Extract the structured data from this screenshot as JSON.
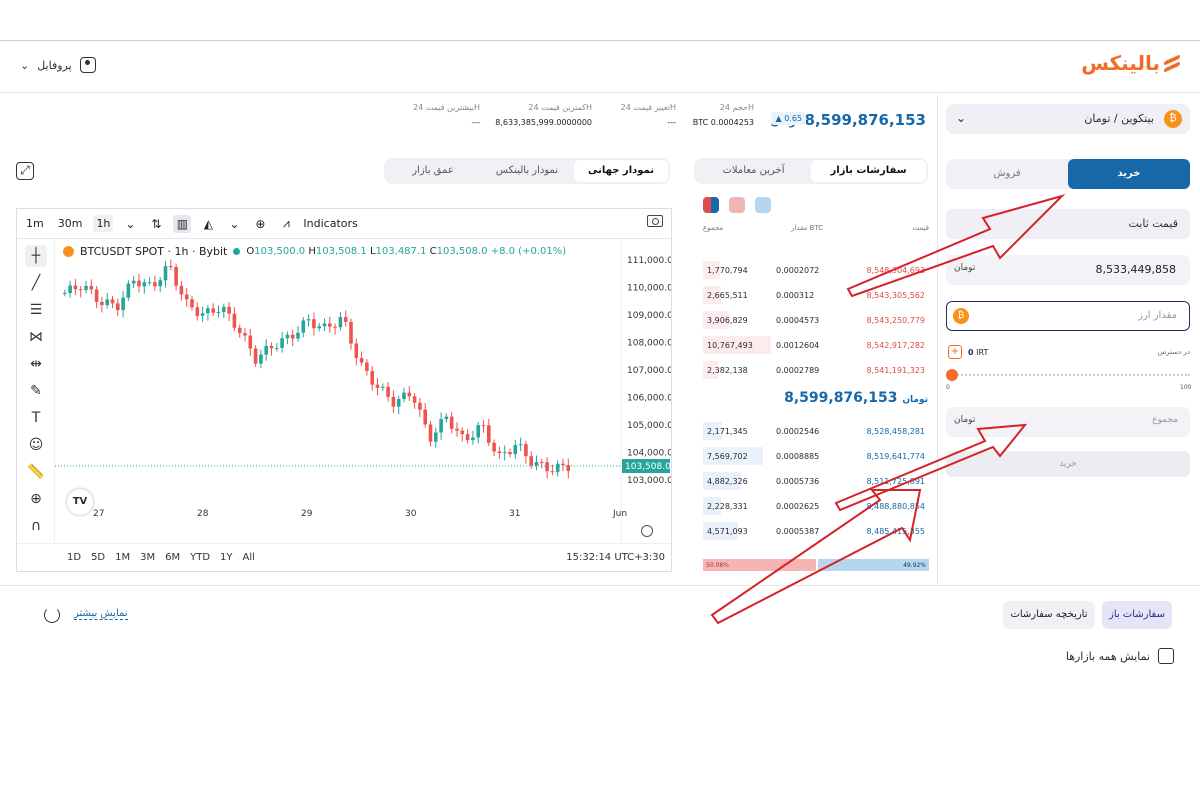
{
  "header": {
    "brand": "بالینکس",
    "profile_label": "پروفایل"
  },
  "stats": {
    "last_price": "8,599,876,153",
    "change_pct": "0.65",
    "volume_label": "حجم 24H",
    "volume_value": "BTC 0.0004253",
    "change_label": "تغییر قیمت 24H",
    "change_value": "---",
    "low_label": "کمترین قیمت 24H",
    "low_value": "8,633,385,999.0000000",
    "high_label": "بیشترین قیمت 24H",
    "high_value": "---"
  },
  "chart_tabs": [
    "نمودار جهانی",
    "نمودار بالینکس",
    "عمق بازار"
  ],
  "tv": {
    "timeframes": [
      "1m",
      "30m",
      "1h"
    ],
    "indicators_label": "Indicators",
    "symbol": "BTCUSDT SPOT · 1h · Bybit",
    "ohlc": {
      "o": "103,500.0",
      "h": "103,508.1",
      "l": "103,487.1",
      "c": "103,508.0",
      "chg": "+8.0 (+0.01%)"
    },
    "price_ticks": [
      "111,000.0",
      "110,000.0",
      "109,000.0",
      "108,000.0",
      "107,000.0",
      "106,000.0",
      "105,000.0",
      "104,000.0",
      "103,000.0"
    ],
    "last_tag": "103,508.0",
    "date_ticks": [
      "27",
      "28",
      "29",
      "30",
      "31",
      "Jun"
    ],
    "ranges": [
      "1D",
      "5D",
      "1M",
      "3M",
      "6M",
      "YTD",
      "1Y",
      "All"
    ],
    "clock": "15:32:14 UTC+3:30"
  },
  "orderbook": {
    "tabs": [
      "سفارشات بازار",
      "آخرین معاملات"
    ],
    "head_price": "قیمت",
    "head_amount": "مقدار BTC",
    "head_total": "مجموع",
    "asks": [
      {
        "total": "1,770,794",
        "amount": "0.0002072",
        "price": "8,548,304,693",
        "fill": 0.25
      },
      {
        "total": "2,665,511",
        "amount": "0.000312",
        "price": "8,543,305,562",
        "fill": 0.26
      },
      {
        "total": "3,906,829",
        "amount": "0.0004573",
        "price": "8,543,250,779",
        "fill": 0.38
      },
      {
        "total": "10,767,493",
        "amount": "0.0012604",
        "price": "8,542,917,282",
        "fill": 1.0
      },
      {
        "total": "2,382,138",
        "amount": "0.0002789",
        "price": "8,541,191,323",
        "fill": 0.22
      }
    ],
    "mid_price": "8,599,876,153",
    "bids": [
      {
        "total": "2,171,345",
        "amount": "0.0002546",
        "price": "8,528,458,281",
        "fill": 0.28
      },
      {
        "total": "7,569,702",
        "amount": "0.0008885",
        "price": "8,519,641,774",
        "fill": 0.88
      },
      {
        "total": "4,882,326",
        "amount": "0.0005736",
        "price": "8,511,725,891",
        "fill": 0.56
      },
      {
        "total": "2,228,331",
        "amount": "0.0002625",
        "price": "8,488,880,854",
        "fill": 0.26
      },
      {
        "total": "4,571,093",
        "amount": "0.0005387",
        "price": "8,485,415,355",
        "fill": 0.52
      }
    ],
    "sell_ratio": "50.08%",
    "buy_ratio": "49.92%"
  },
  "trade": {
    "market": "بیتکوین / تومان",
    "buy_tab": "خرید",
    "sell_tab": "فروش",
    "order_type": "قیمت ثابت",
    "price_value": "8,533,449,858",
    "amount_placeholder": "مقدار ارز",
    "available_label": "در دسترس",
    "available_value": "0",
    "available_unit": "IRT",
    "slider_min": "0",
    "slider_max": "100",
    "slider_level": 0,
    "total_placeholder": "مجموع",
    "submit_label": "خرید"
  },
  "bottom": {
    "open_orders": "سفارشات باز",
    "order_history": "تاریخچه سفارشات",
    "show_more": "نمایش بیشتر",
    "all_markets": "نمایش همه بازارها"
  },
  "colors": {
    "brand": "#f26b2a",
    "primary": "#1668a8",
    "up": "#26a69a",
    "down": "#ef5350",
    "annotation": "#d6202a"
  }
}
